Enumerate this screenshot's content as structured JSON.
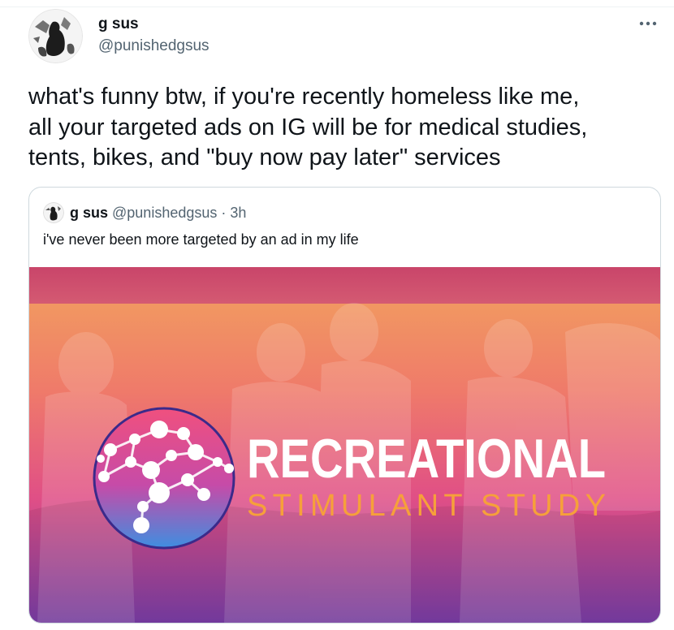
{
  "tweet": {
    "author": {
      "name": "g sus",
      "handle": "@punishedgsus"
    },
    "text_lines": [
      "what's funny btw, if you're recently homeless like me,",
      "all your targeted ads on IG will be for medical studies,",
      "tents, bikes, and \"buy now pay later\" services"
    ],
    "more_icon": "ellipsis-icon"
  },
  "quoted": {
    "author": {
      "name": "g sus",
      "handle": "@punishedgsus"
    },
    "separator": "·",
    "time": "3h",
    "text": "i've never been more targeted by an ad in my life",
    "media": {
      "headline": "RECREATIONAL",
      "subline": "STIMULANT STUDY",
      "logo_icon": "molecule-brain-icon"
    }
  },
  "colors": {
    "handle": "#536471",
    "border": "#cfd9de",
    "ad_top": "#f2a35e",
    "ad_mid": "#e9567a",
    "ad_bottom": "#7b3ea8",
    "subline": "#f6a03a"
  }
}
